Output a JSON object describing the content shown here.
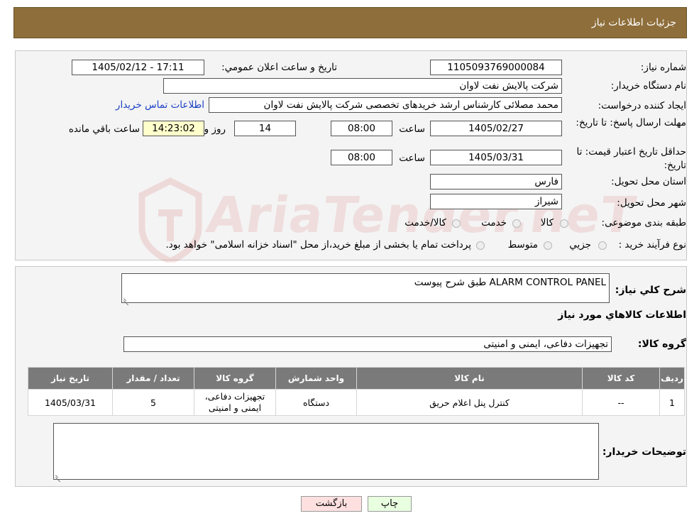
{
  "header": {
    "title": "جزئیات اطلاعات نیاز"
  },
  "watermark": "AriaTender.neT",
  "fields": {
    "need_number_label": "شماره نیاز:",
    "need_number": "1105093769000084",
    "announce_label": "تاريخ و ساعت اعلان عمومي:",
    "announce_value": "1405/02/12 - 17:11",
    "buyer_org_label": "نام دستگاه خريدار:",
    "buyer_org": "شرکت پالايش نفت لاوان",
    "creator_label": "ايجاد کننده درخواست:",
    "creator": "محمد مصلائی کارشناس ارشد خریدهای تخصصی شرکت پالایش نفت لاوان",
    "contact_link": "اطلاعات تماس خريدار",
    "deadline_label": "مهلت ارسال پاسخ: تا تاريخ:",
    "deadline_date": "1405/02/27",
    "time_label": "ساعت",
    "deadline_time": "08:00",
    "days_value": "14",
    "days_label": "روز و",
    "remaining_time": "14:23:02",
    "remaining_label": "ساعت باقي مانده",
    "validity_label": "حداقل تاريخ اعتبار قيمت: تا تاريخ:",
    "validity_date": "1405/03/31",
    "validity_time": "08:00",
    "province_label": "استان محل تحويل:",
    "province": "فارس",
    "city_label": "شهر محل تحويل:",
    "city": "شيراز",
    "category_label": "طبقه بندی موضوعی:",
    "category_options": [
      "کالا",
      "خدمت",
      "کالا/خدمت"
    ],
    "process_label": "نوع فرآيند خريد :",
    "process_options": [
      "جزيي",
      "متوسط"
    ],
    "process_note": "پرداخت تمام يا بخشی از مبلغ خريد،از محل \"اسناد خزانه اسلامی\" خواهد بود."
  },
  "description": {
    "label": "شرح کلي نياز:",
    "value": "ALARM CONTROL PANEL طبق شرح پیوست"
  },
  "goods": {
    "section_title": "اطلاعات کالاهاي مورد نياز",
    "group_label": "گروه کالا:",
    "group_value": "تجهيزات دفاعی، ايمنی و امنيتی",
    "columns": [
      "رديف",
      "کد کالا",
      "نام کالا",
      "واحد شمارش",
      "گروه کالا",
      "تعداد / مقدار",
      "تاريخ نياز"
    ],
    "rows": [
      {
        "row": "1",
        "code": "--",
        "name": "کنترل پنل اعلام حریق",
        "unit": "دستگاه",
        "group": "تجهيزات دفاعی، ايمنی و امنيتی",
        "qty": "5",
        "date": "1405/03/31"
      }
    ]
  },
  "buyer_notes": {
    "label": "توضيحات خريدار:",
    "value": ""
  },
  "buttons": {
    "print": "چاپ",
    "back": "بازگشت"
  },
  "colors": {
    "header_bg": "#8e6e3a",
    "table_header_bg": "#7a7a7a",
    "back_button_bg": "#ffe0e0",
    "print_button_bg": "#e8ffe0"
  }
}
